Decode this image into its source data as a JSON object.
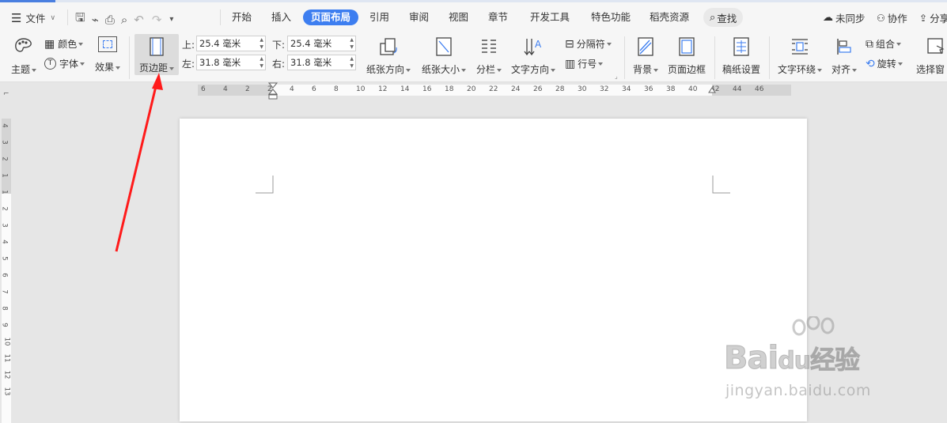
{
  "menubar": {
    "file": "文件",
    "tabs": [
      "开始",
      "插入",
      "页面布局",
      "引用",
      "审阅",
      "视图",
      "章节",
      "开发工具",
      "特色功能",
      "稻壳资源"
    ],
    "search": "查找",
    "sync": "未同步",
    "collab": "协作",
    "share": "分享"
  },
  "ribbon": {
    "theme": "主题",
    "colors": "颜色",
    "fonts": "字体",
    "effects": "效果",
    "margins": "页边距",
    "top_label": "上:",
    "top_value": "25.4 毫米",
    "bottom_label": "下:",
    "bottom_value": "25.4 毫米",
    "left_label": "左:",
    "left_value": "31.8 毫米",
    "right_label": "右:",
    "right_value": "31.8 毫米",
    "orientation": "纸张方向",
    "size": "纸张大小",
    "columns": "分栏",
    "text_direction": "文字方向",
    "breaks": "分隔符",
    "line_numbers": "行号",
    "background": "背景",
    "page_border": "页面边框",
    "manuscript": "稿纸设置",
    "wrap_text": "文字环绕",
    "align": "对齐",
    "group": "组合",
    "rotate": "旋转",
    "select_pane": "选择窗"
  },
  "ruler": {
    "h_ticks": [
      "6",
      "4",
      "2",
      "2",
      "4",
      "6",
      "8",
      "10",
      "12",
      "14",
      "16",
      "18",
      "20",
      "22",
      "24",
      "26",
      "28",
      "30",
      "32",
      "34",
      "36",
      "38",
      "40",
      "42",
      "44",
      "46"
    ],
    "v_ticks": [
      "4",
      "3",
      "2",
      "1",
      "1",
      "2",
      "3",
      "4",
      "5",
      "6",
      "7",
      "8",
      "9",
      "10",
      "11",
      "12",
      "13"
    ]
  },
  "watermark": {
    "brand": "Bai",
    "brand2": "du",
    "cn": "经验",
    "url": "jingyan.baidu.com"
  },
  "colors": {
    "accent": "#3d7ef0",
    "arrow": "#ff1a1a"
  }
}
